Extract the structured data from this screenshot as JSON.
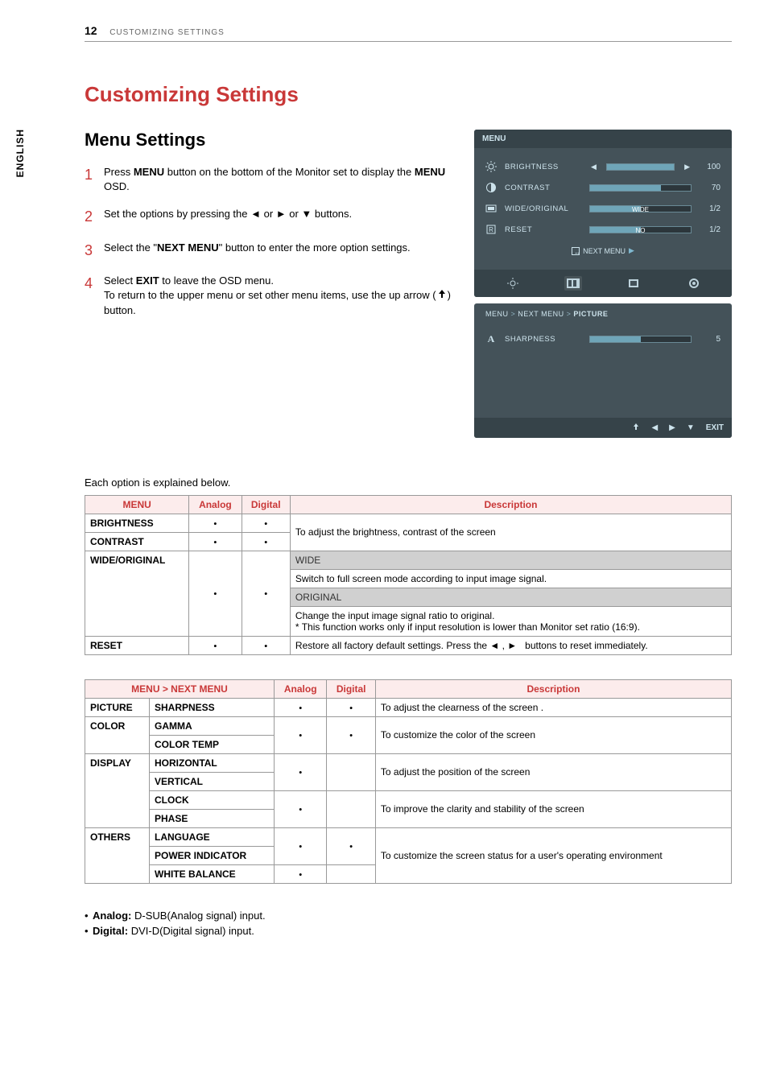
{
  "header": {
    "page_num": "12",
    "title": "CUSTOMIZING SETTINGS",
    "side_tab": "ENGLISH"
  },
  "titles": {
    "main": "Customizing Settings",
    "sub": "Menu Settings"
  },
  "steps": [
    {
      "num": "1",
      "html_parts": [
        "Press ",
        "MENU",
        " button on the bottom of the Monitor set to display the ",
        "MENU",
        " OSD."
      ]
    },
    {
      "num": "2",
      "html_parts": [
        "Set the options by pressing the ◄ or ► or ▼ buttons."
      ]
    },
    {
      "num": "3",
      "html_parts": [
        "Select the \"",
        "NEXT MENU",
        "\" button to enter the more option settings."
      ]
    },
    {
      "num": "4",
      "html_parts": [
        "Select ",
        "EXIT",
        " to leave the OSD menu.\nTo return to the upper menu or set other menu items, use the up arrow (",
        "ICON_UP",
        ") button."
      ]
    }
  ],
  "osd": {
    "panel1": {
      "title": "MENU",
      "rows": [
        {
          "icon": "sun",
          "label": "BRIGHTNESS",
          "arrows": true,
          "value": "100",
          "fill": 100,
          "sliderText": ""
        },
        {
          "icon": "contrast",
          "label": "CONTRAST",
          "arrows": false,
          "value": "70",
          "fill": 70,
          "sliderText": ""
        },
        {
          "icon": "wide",
          "label": "WIDE/ORIGINAL",
          "arrows": false,
          "value": "1/2",
          "fill": 50,
          "sliderText": "WIDE"
        },
        {
          "icon": "reset",
          "label": "RESET",
          "arrows": false,
          "value": "1/2",
          "fill": 50,
          "sliderText": "NO"
        }
      ],
      "next_label": "NEXT MENU"
    },
    "nav_icons": [
      "sun-sel",
      "picture-sel",
      "color-sel",
      "display-sel",
      "others-sel"
    ],
    "panel2": {
      "breadcrumb": [
        "MENU",
        "NEXT MENU",
        "PICTURE"
      ],
      "rows": [
        {
          "icon": "A",
          "label": "SHARPNESS",
          "value": "5",
          "fill": 50
        }
      ]
    },
    "footer": {
      "exit": "EXIT"
    }
  },
  "intro": "Each option is explained below.",
  "table1": {
    "headers": [
      "MENU",
      "Analog",
      "Digital",
      "Description"
    ],
    "rows": {
      "brightness": {
        "name": "BRIGHTNESS"
      },
      "contrast": {
        "name": "CONTRAST"
      },
      "bc_desc": "To adjust the brightness, contrast of the screen",
      "wide_orig": {
        "name": "WIDE/ORIGINAL",
        "wide_head": "WIDE",
        "wide_desc": "Switch to full screen mode according to input image signal.",
        "orig_head": "ORIGINAL",
        "orig_desc": "Change the input image signal ratio to original.\n* This function works only if input resolution is lower than Monitor set ratio (16:9)."
      },
      "reset": {
        "name": "RESET",
        "desc_pre": "Restore all factory default settings. Press the ◄ , ►",
        "desc_post": "buttons to reset immediately."
      }
    }
  },
  "table2": {
    "header_group": "MENU > NEXT MENU",
    "headers": [
      "Analog",
      "Digital",
      "Description"
    ],
    "rows": {
      "picture": {
        "cat": "PICTURE",
        "sub": "SHARPNESS",
        "desc": "To adjust the clearness of the screen ."
      },
      "color": {
        "cat": "COLOR",
        "subs": [
          "GAMMA",
          "COLOR TEMP"
        ],
        "desc": "To customize the color of the screen"
      },
      "display": {
        "cat": "DISPLAY",
        "group1": {
          "subs": [
            "HORIZONTAL",
            "VERTICAL"
          ],
          "desc": "To adjust the position of the screen"
        },
        "group2": {
          "subs": [
            "CLOCK",
            "PHASE"
          ],
          "desc": "To improve the clarity and stability of the screen"
        }
      },
      "others": {
        "cat": "OTHERS",
        "subs": [
          "LANGUAGE",
          "POWER INDICATOR",
          "WHITE BALANCE"
        ],
        "desc": "To customize the screen status for a user's operating environment"
      }
    }
  },
  "footnotes": {
    "analog": {
      "label": "Analog:",
      "text": "D-SUB(Analog signal) input."
    },
    "digital": {
      "label": "Digital:",
      "text": "DVI-D(Digital signal) input."
    }
  }
}
